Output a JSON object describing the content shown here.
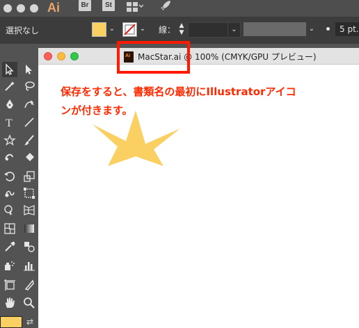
{
  "app_bar": {
    "app_name": "Ai",
    "bridge_icon": "Br",
    "stock_icon": "St",
    "layout_icon": "workspace-grid-icon",
    "gpu_icon": "rocket-icon"
  },
  "control_bar": {
    "selection_label": "選択なし",
    "fill_color": "#f9d061",
    "stroke_label": "線：",
    "stroke_width_value": "",
    "point_size": "5 pt."
  },
  "document": {
    "title": "MacStar.ai @ 100% (CMYK/GPU プレビュー)",
    "file_icon_label": "Ai",
    "star_color": "#f9d061"
  },
  "annotation": {
    "text_line1": "保存をすると、書類名の最初にIllustratorアイコ",
    "text_line2": "ンが付きます。",
    "color": "#ff2a00"
  },
  "toolbox": {
    "tools": [
      "selection-tool",
      "direct-selection-tool",
      "magic-wand-tool",
      "lasso-tool",
      "pen-tool",
      "curvature-tool",
      "type-tool",
      "line-tool",
      "shape-tool",
      "paintbrush-tool",
      "shaper-tool",
      "eraser-tool",
      "rotate-tool",
      "scale-tool",
      "warp-tool",
      "free-transform-tool",
      "shape-builder-tool",
      "perspective-grid-tool",
      "mesh-tool",
      "gradient-tool",
      "eyedropper-tool",
      "blend-tool",
      "symbol-sprayer-tool",
      "graph-tool",
      "artboard-tool",
      "slice-tool",
      "hand-tool",
      "zoom-tool"
    ]
  }
}
